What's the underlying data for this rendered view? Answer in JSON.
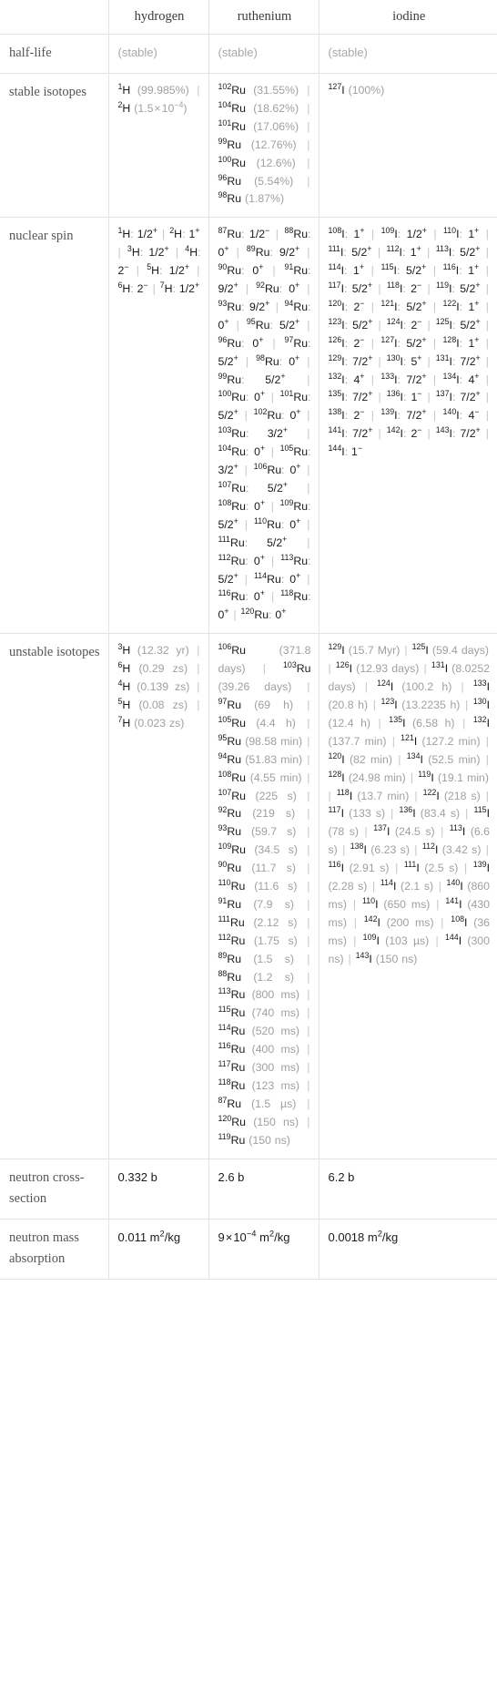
{
  "table": {
    "columns": [
      {
        "key": "label",
        "label": ""
      },
      {
        "key": "hydrogen",
        "label": "hydrogen"
      },
      {
        "key": "ruthenium",
        "label": "ruthenium"
      },
      {
        "key": "iodine",
        "label": "iodine"
      }
    ],
    "rows": [
      {
        "label": "half-life",
        "hydrogen": "(stable)",
        "ruthenium": "(stable)",
        "iodine": "(stable)"
      },
      {
        "label": "stable isotopes",
        "hydrogen": "<sup>1</sup>H (99.985%) | <sup>2</sup>H (1.5×10<sup>-4</sup>)",
        "ruthenium": "<sup>102</sup>Ru (31.55%) | <sup>104</sup>Ru (18.62%) | <sup>101</sup>Ru (17.06%) | <sup>99</sup>Ru (12.76%) | <sup>100</sup>Ru (12.6%) | <sup>96</sup>Ru (5.54%) | <sup>98</sup>Ru (1.87%)",
        "iodine": "<sup>127</sup>I (100%)"
      },
      {
        "label": "nuclear spin",
        "hydrogen": "<sup>1</sup>H: 1/2+ | <sup>2</sup>H: 1+ | <sup>3</sup>H: 1/2+ | <sup>4</sup>H: 2- | <sup>5</sup>H: 1/2+ | <sup>6</sup>H: 2- | <sup>7</sup>H: 1/2+",
        "ruthenium": "<sup>87</sup>Ru: 1/2- | <sup>88</sup>Ru: 0+ | <sup>89</sup>Ru: 9/2+ | <sup>90</sup>Ru: 0+ | <sup>91</sup>Ru: 9/2+ | <sup>92</sup>Ru: 0+ | <sup>93</sup>Ru: 9/2+ | <sup>94</sup>Ru: 0+ | <sup>95</sup>Ru: 5/2+ | <sup>96</sup>Ru: 0+ | <sup>97</sup>Ru: 5/2+ | <sup>98</sup>Ru: 0+ | <sup>99</sup>Ru: 5/2+ | <sup>100</sup>Ru: 0+ | <sup>101</sup>Ru: 5/2+ | <sup>102</sup>Ru: 0+ | <sup>103</sup>Ru: 3/2+ | <sup>104</sup>Ru: 0+ | <sup>105</sup>Ru: 3/2+ | <sup>106</sup>Ru: 0+ | <sup>107</sup>Ru: 5/2+ | <sup>108</sup>Ru: 0+ | <sup>109</sup>Ru: 5/2+ | <sup>110</sup>Ru: 0+ | <sup>111</sup>Ru: 5/2+ | <sup>112</sup>Ru: 0+ | <sup>113</sup>Ru: 5/2+ | <sup>114</sup>Ru: 0+ | <sup>116</sup>Ru: 0+ | <sup>118</sup>Ru: 0+ | <sup>120</sup>Ru: 0+",
        "iodine": "<sup>108</sup>I: 1+ | <sup>109</sup>I: 1/2+ | <sup>110</sup>I: 1+ | <sup>111</sup>I: 5/2+ | <sup>112</sup>I: 1+ | <sup>113</sup>I: 5/2+ | <sup>114</sup>I: 1+ | <sup>115</sup>I: 5/2+ | <sup>116</sup>I: 1+ | <sup>117</sup>I: 5/2+ | <sup>118</sup>I: 2- | <sup>119</sup>I: 5/2+ | <sup>120</sup>I: 2- | <sup>121</sup>I: 5/2+ | <sup>122</sup>I: 1+ | <sup>123</sup>I: 5/2+ | <sup>124</sup>I: 2- | <sup>125</sup>I: 5/2+ | <sup>126</sup>I: 2- | <sup>127</sup>I: 5/2+ | <sup>128</sup>I: 1+ | <sup>129</sup>I: 7/2+ | <sup>130</sup>I: 5+ | <sup>131</sup>I: 7/2+ | <sup>132</sup>I: 4+ | <sup>133</sup>I: 7/2+ | <sup>134</sup>I: 4+ | <sup>135</sup>I: 7/2+ | <sup>136</sup>I: 1- | <sup>137</sup>I: 7/2+ | <sup>138</sup>I: 2- | <sup>139</sup>I: 7/2+ | <sup>140</sup>I: 4- | <sup>141</sup>I: 7/2+ | <sup>142</sup>I: 2- | <sup>143</sup>I: 7/2+ | <sup>144</sup>I: 1-"
      },
      {
        "label": "unstable isotopes",
        "hydrogen": "<sup>3</sup>H (12.32 yr) | <sup>6</sup>H (0.29 zs) | <sup>4</sup>H (0.139 zs) | <sup>5</sup>H (0.08 zs) | <sup>7</sup>H (0.023 zs)",
        "ruthenium": "<sup>106</sup>Ru (371.8 days) | <sup>103</sup>Ru (39.26 days) | <sup>97</sup>Ru (69 h) | <sup>105</sup>Ru (4.4 h) | <sup>95</sup>Ru (98.58 min) | <sup>94</sup>Ru (51.83 min) | <sup>108</sup>Ru (4.55 min) | <sup>107</sup>Ru (225 s) | <sup>92</sup>Ru (219 s) | <sup>93</sup>Ru (59.7 s) | <sup>109</sup>Ru (34.5 s) | <sup>90</sup>Ru (11.7 s) | <sup>110</sup>Ru (11.6 s) | <sup>91</sup>Ru (7.9 s) | <sup>111</sup>Ru (2.12 s) | <sup>112</sup>Ru (1.75 s) | <sup>89</sup>Ru (1.5 s) | <sup>88</sup>Ru (1.2 s) | <sup>113</sup>Ru (800 ms) | <sup>115</sup>Ru (740 ms) | <sup>114</sup>Ru (520 ms) | <sup>116</sup>Ru (400 ms) | <sup>117</sup>Ru (300 ms) | <sup>118</sup>Ru (123 ms) | <sup>87</sup>Ru (1.5 µs) | <sup>120</sup>Ru (150 ns) | <sup>119</sup>Ru (150 ns)",
        "iodine": "<sup>129</sup>I (15.7 Myr) | <sup>125</sup>I (59.4 days) | <sup>126</sup>I (12.93 days) | <sup>131</sup>I (8.0252 days) | <sup>124</sup>I (100.2 h) | <sup>133</sup>I (20.8 h) | <sup>123</sup>I (13.2235 h) | <sup>130</sup>I (12.4 h) | <sup>135</sup>I (6.58 h) | <sup>132</sup>I (137.7 min) | <sup>121</sup>I (127.2 min) | <sup>120</sup>I (82 min) | <sup>134</sup>I (52.5 min) | <sup>128</sup>I (24.98 min) | <sup>119</sup>I (19.1 min) | <sup>118</sup>I (13.7 min) | <sup>122</sup>I (218 s) | <sup>117</sup>I (133 s) | <sup>136</sup>I (83.4 s) | <sup>115</sup>I (78 s) | <sup>137</sup>I (24.5 s) | <sup>113</sup>I (6.6 s) | <sup>138</sup>I (6.23 s) | <sup>112</sup>I (3.42 s) | <sup>116</sup>I (2.91 s) | <sup>111</sup>I (2.5 s) | <sup>139</sup>I (2.28 s) | <sup>114</sup>I (2.1 s) | <sup>140</sup>I (860 ms) | <sup>110</sup>I (650 ms) | <sup>141</sup>I (430 ms) | <sup>142</sup>I (200 ms) | <sup>108</sup>I (36 ms) | <sup>109</sup>I (103 µs) | <sup>144</sup>I (300 ns) | <sup>143</sup>I (150 ns)"
      },
      {
        "label": "neutron cross-section",
        "hydrogen": "0.332 b",
        "ruthenium": "2.6 b",
        "iodine": "6.2 b"
      },
      {
        "label": "neutron mass absorption",
        "hydrogen": "0.011 m<sup>2</sup>/kg",
        "ruthenium": "9×10<sup>-4</sup> m<sup>2</sup>/kg",
        "iodine": "0.0018 m<sup>2</sup>/kg"
      }
    ]
  },
  "colors": {
    "border": "#e4e4e4",
    "text": "#1a1a1a",
    "muted": "#a8a8a8",
    "label": "#555555"
  }
}
